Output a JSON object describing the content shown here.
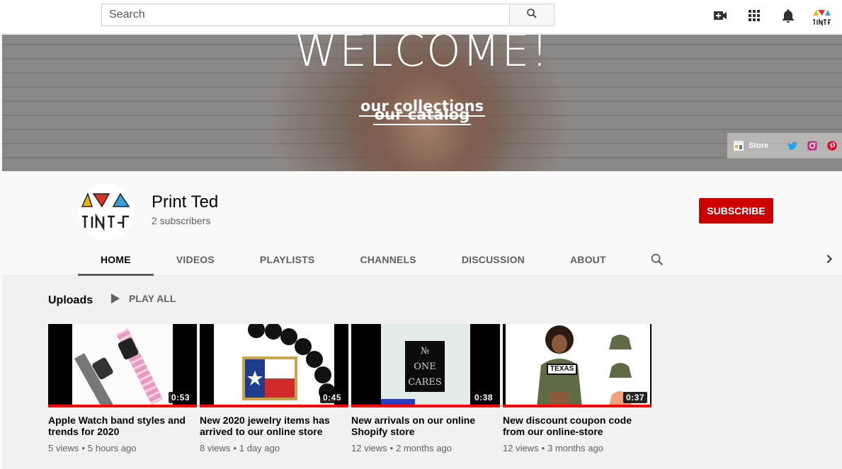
{
  "masthead": {
    "search_placeholder": "Search",
    "icons": [
      "search-icon",
      "create-video-icon",
      "apps-icon",
      "notifications-icon"
    ]
  },
  "banner": {
    "welcome": "WELCOME!",
    "link1": "our collections",
    "link2": "our catalog",
    "store_label": "Store",
    "social": [
      "twitter-icon",
      "instagram-icon",
      "pinterest-icon"
    ]
  },
  "channel": {
    "name": "Print Ted",
    "subscribers": "2 subscribers",
    "subscribe_label": "SUBSCRIBE",
    "tabs": [
      "HOME",
      "VIDEOS",
      "PLAYLISTS",
      "CHANNELS",
      "DISCUSSION",
      "ABOUT"
    ],
    "active_tab": "HOME"
  },
  "shelf": {
    "title": "Uploads",
    "play_all": "PLAY ALL",
    "videos": [
      {
        "title": "Apple Watch band styles and trends for 2020",
        "duration": "0:53",
        "views": "5 views",
        "age": "5 hours ago"
      },
      {
        "title": "New 2020 jewelry items has arrived to our online store",
        "duration": "0:45",
        "views": "8 views",
        "age": "1 day ago"
      },
      {
        "title": "New arrivals on our online Shopify store",
        "duration": "0:38",
        "views": "12 views",
        "age": "2 months ago"
      },
      {
        "title": "New discount coupon code from our online-store",
        "duration": "0:37",
        "views": "12 views",
        "age": "3 months ago"
      }
    ]
  },
  "thumb_text": {
    "shirt_lines": [
      "№",
      "ONE",
      "CARES"
    ],
    "hoodie_text": "TEXAS"
  },
  "colors": {
    "subscribe": "#cc0000",
    "progress": "#ff0000",
    "twitter": "#1da1f2",
    "instagram": "#c13584",
    "pinterest": "#e60023"
  }
}
